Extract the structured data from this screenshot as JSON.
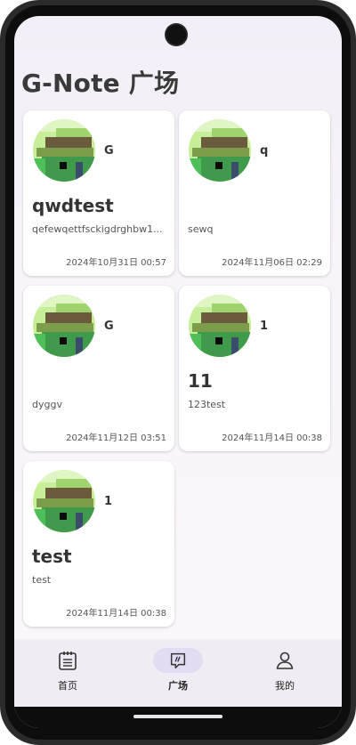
{
  "page": {
    "title": "G-Note 广场"
  },
  "posts": [
    {
      "author": "G",
      "title": "qwdtest",
      "body": "qefewqettfsckigdrghbw1...",
      "date": "2024年10月31日 00:57"
    },
    {
      "author": "q",
      "title": "",
      "body": "sewq",
      "date": "2024年11月06日 02:29"
    },
    {
      "author": "G",
      "title": "",
      "body": "dyggv",
      "date": "2024年11月12日 03:51"
    },
    {
      "author": "1",
      "title": "11",
      "body": "123test",
      "date": "2024年11月14日 00:38"
    },
    {
      "author": "1",
      "title": "test",
      "body": "test",
      "date": "2024年11月14日 00:38"
    }
  ],
  "nav": {
    "items": [
      {
        "label": "首页",
        "icon": "notebook-icon",
        "active": false
      },
      {
        "label": "广场",
        "icon": "chat-square-icon",
        "active": true
      },
      {
        "label": "我的",
        "icon": "person-icon",
        "active": false
      }
    ]
  },
  "colors": {
    "nav_active_pill": "#e3dcf3",
    "background": "#f3eef7"
  }
}
